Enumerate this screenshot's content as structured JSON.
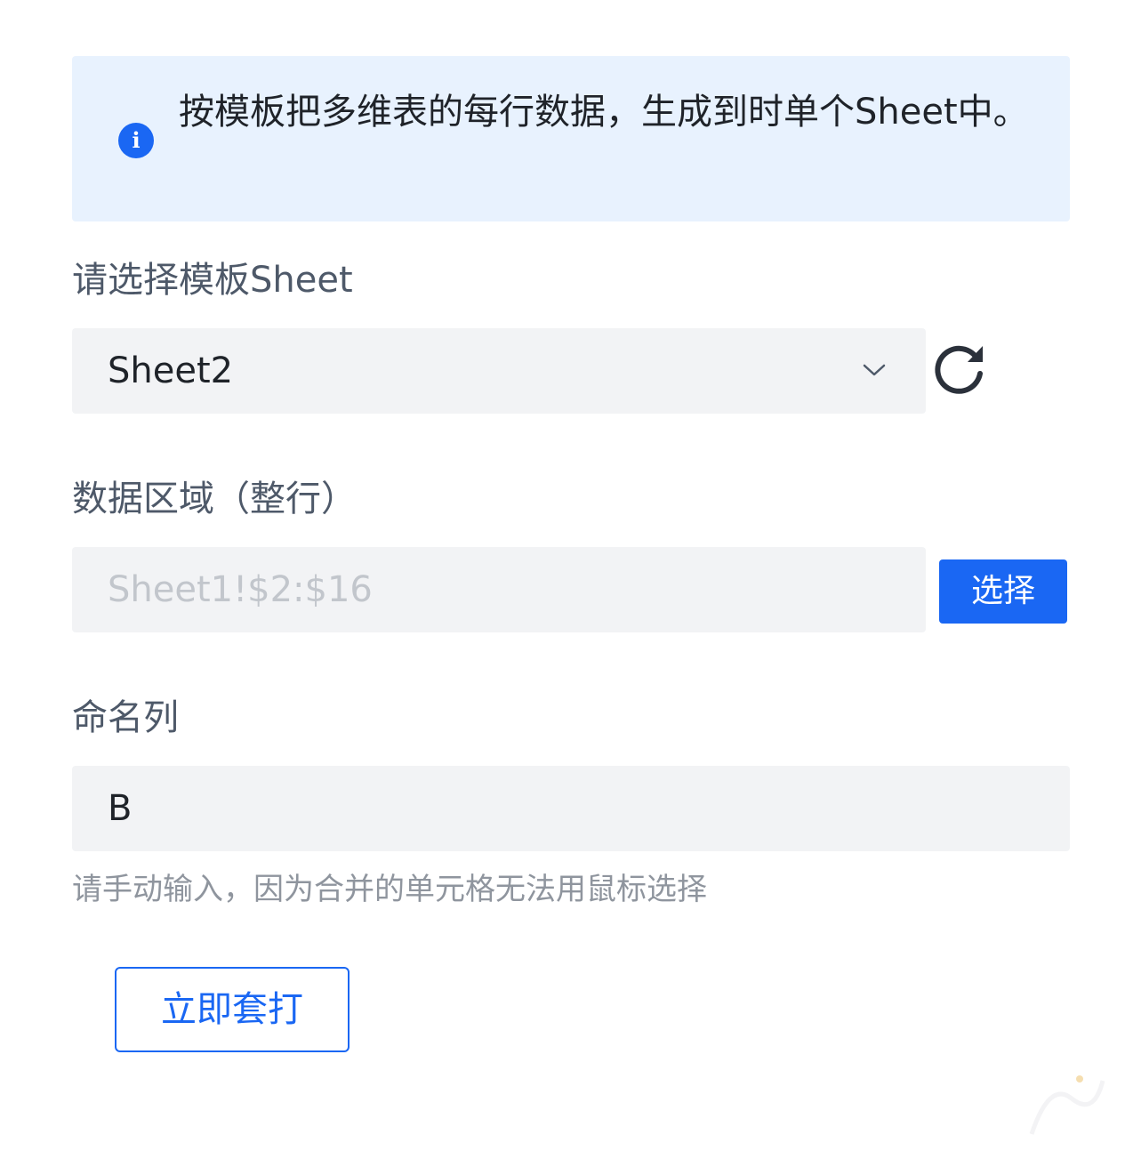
{
  "alert": {
    "icon": "info-icon",
    "text": "按模板把多维表的每行数据，生成到时单个Sheet中。"
  },
  "template_sheet": {
    "label": "请选择模板Sheet",
    "value": "Sheet2",
    "dropdown_icon": "chevron-down-icon",
    "refresh_icon": "refresh-icon"
  },
  "data_range": {
    "label": "数据区域（整行）",
    "placeholder": "Sheet1!$2:$16",
    "select_button": "选择"
  },
  "name_column": {
    "label": "命名列",
    "value": "B",
    "hint": "请手动输入，因为合并的单元格无法用鼠标选择"
  },
  "action": {
    "label": "立即套打"
  },
  "colors": {
    "primary": "#1a67f3",
    "alert_background": "#e8f2fe",
    "field_background": "#f2f3f5"
  }
}
